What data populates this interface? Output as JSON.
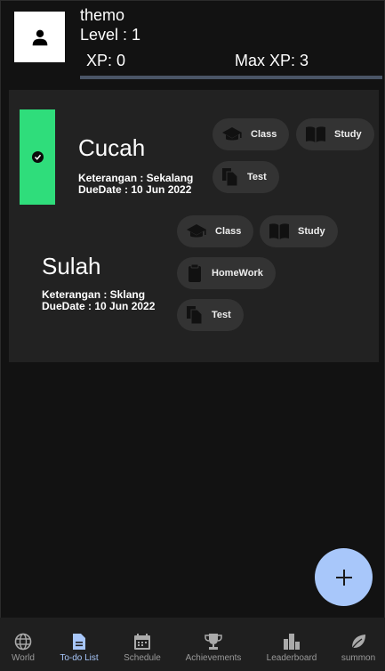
{
  "profile": {
    "username": "themo",
    "level": "Level : 1",
    "xp": "XP: 0",
    "max_xp": "Max XP: 3",
    "xp_progress": 0
  },
  "tasks": [
    {
      "title": "Cucah",
      "keterangan": "Keterangan : Sekalang",
      "due": "DueDate : 10 Jun 2022",
      "completed": true,
      "tags": [
        {
          "label": "Class",
          "icon": "school-icon"
        },
        {
          "label": "Study",
          "icon": "book-icon"
        },
        {
          "label": "Test",
          "icon": "file-copy-icon"
        }
      ]
    },
    {
      "title": "Sulah",
      "keterangan": "Keterangan : Sklang",
      "due": "DueDate : 10 Jun 2022",
      "completed": false,
      "tags": [
        {
          "label": "Class",
          "icon": "school-icon"
        },
        {
          "label": "Study",
          "icon": "book-icon"
        },
        {
          "label": "HomeWork",
          "icon": "clipboard-icon"
        },
        {
          "label": "Test",
          "icon": "file-copy-icon"
        }
      ]
    }
  ],
  "fab": {
    "icon": "plus-icon"
  },
  "nav": {
    "active": "To-do List",
    "items": [
      {
        "label": "World",
        "icon": "globe-icon"
      },
      {
        "label": "To-do List",
        "icon": "document-icon"
      },
      {
        "label": "Schedule",
        "icon": "calendar-icon"
      },
      {
        "label": "Achievements",
        "icon": "trophy-icon"
      },
      {
        "label": "Leaderboard",
        "icon": "leaderboard-icon"
      },
      {
        "label": "summon",
        "icon": "leaf-icon"
      }
    ]
  },
  "colors": {
    "background": "#121212",
    "panel": "#222222",
    "chip": "#333333",
    "completed_strip": "#2fdd7b",
    "accent": "#a8c7fa",
    "xp_track": "#4a5566"
  }
}
